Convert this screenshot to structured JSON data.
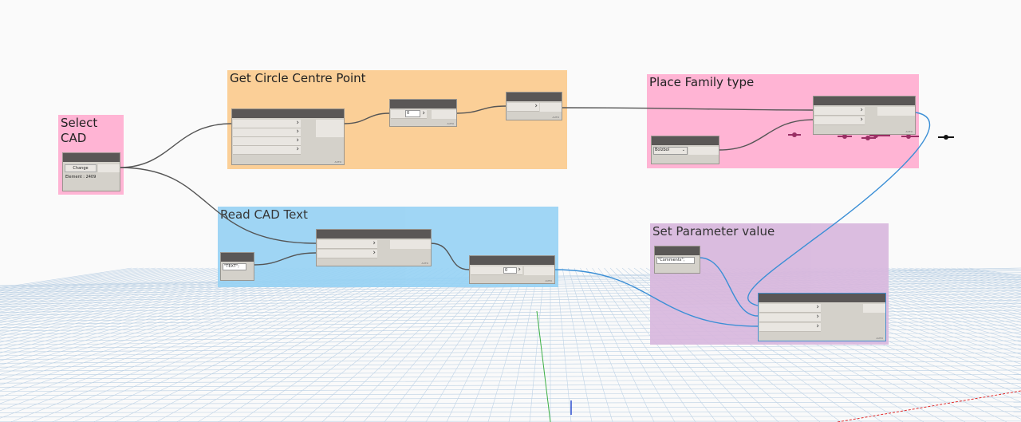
{
  "groups": {
    "select_cad": {
      "title": "Select\nCAD",
      "color": "#ffb4d4"
    },
    "get_circle": {
      "title": "Get Circle Centre Point",
      "color": "#fbcf97"
    },
    "place_family": {
      "title": "Place Family type",
      "color": "#ffb4d4"
    },
    "read_cad": {
      "title": "Read CAD Text",
      "color": "#96d2f4"
    },
    "set_param": {
      "title": "Set Parameter value",
      "color": "#d8b7dd"
    }
  },
  "nodes": {
    "select_cad": {
      "button": "Change",
      "element": "Element : 2409"
    },
    "list_index_1": {
      "value": "0"
    },
    "code_text": {
      "value": "\"TEXT\";"
    },
    "list_index_2": {
      "value": "0"
    },
    "code_comments": {
      "value": "\"Comments\";"
    },
    "family_types": {
      "value": "Bolzbol"
    }
  },
  "footer_label": "AUTO"
}
